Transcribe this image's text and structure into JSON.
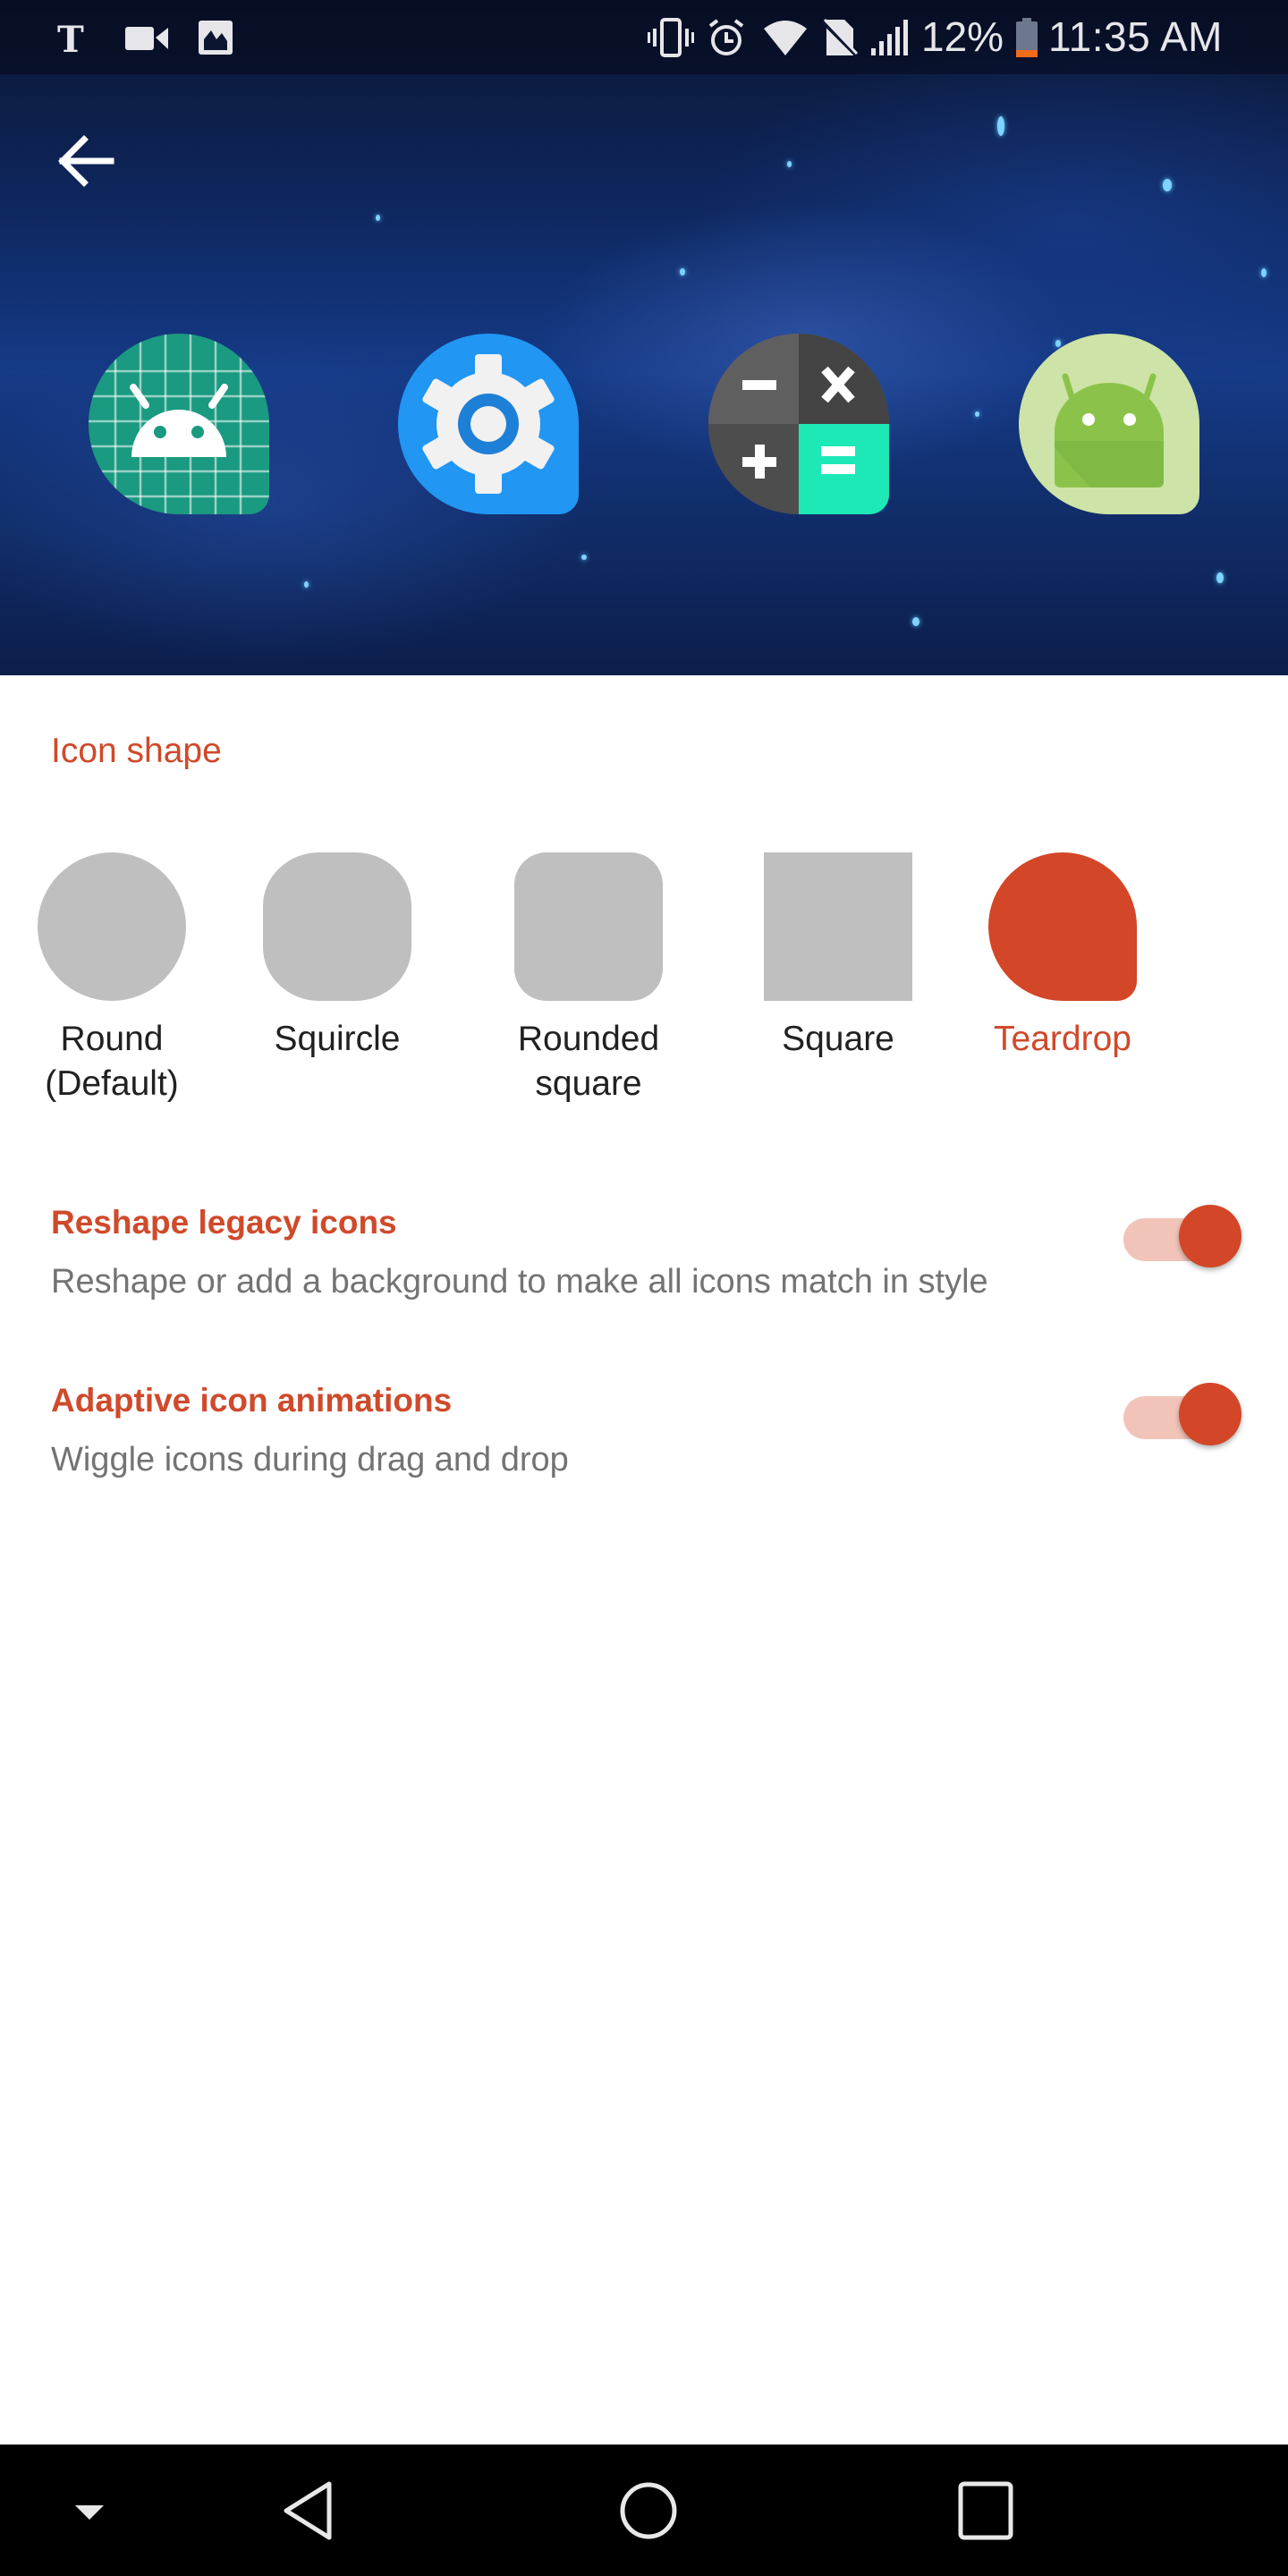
{
  "status_bar": {
    "left_icons": [
      "nytimes-icon",
      "video-camera-icon",
      "image-icon"
    ],
    "right_icons": [
      "vibrate-icon",
      "alarm-icon",
      "wifi-icon",
      "no-sim-icon",
      "signal-icon",
      "battery-icon"
    ],
    "battery_percent": "12%",
    "time": "11:35 AM"
  },
  "header": {
    "back_icon": "arrow-left-icon",
    "preview_icons": [
      {
        "name": "android-dev-app",
        "bg": "#1a9a80"
      },
      {
        "name": "settings-app",
        "bg": "#2196f3"
      },
      {
        "name": "calculator-app",
        "bg": "#5f5f5f"
      },
      {
        "name": "android-app",
        "bg": "#cde3a7"
      }
    ]
  },
  "icon_shape": {
    "heading": "Icon shape",
    "options": [
      {
        "label_line1": "Round",
        "label_line2": "(Default)",
        "selected": false
      },
      {
        "label_line1": "Squircle",
        "label_line2": "",
        "selected": false
      },
      {
        "label_line1": "Rounded",
        "label_line2": "square",
        "selected": false
      },
      {
        "label_line1": "Square",
        "label_line2": "",
        "selected": false
      },
      {
        "label_line1": "Teardrop",
        "label_line2": "",
        "selected": true
      }
    ]
  },
  "settings": [
    {
      "title": "Reshape legacy icons",
      "subtitle": "Reshape or add a background to make all icons match in style",
      "enabled": true
    },
    {
      "title": "Adaptive icon animations",
      "subtitle": "Wiggle icons during drag and drop",
      "enabled": true
    }
  ],
  "nav_bar": {
    "buttons": [
      "hide-nav-icon",
      "back-triangle-icon",
      "home-circle-icon",
      "recents-square-icon"
    ]
  },
  "colors": {
    "accent": "#d34627",
    "accent_text": "#cf4a2b",
    "toggle_track": "#f2c4b9",
    "unselected_shape": "#bfbfbf"
  }
}
